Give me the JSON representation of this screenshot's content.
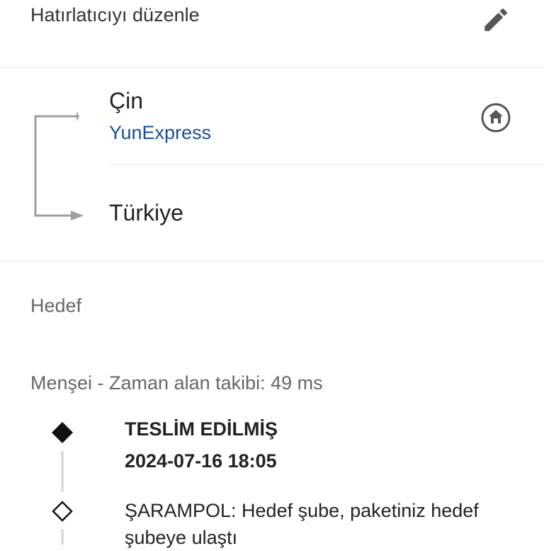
{
  "header": {
    "reminder_label": "Hatırlatıcıyı düzenle",
    "edit_icon": "pencil-icon"
  },
  "route": {
    "origin": "Çin",
    "carrier": "YunExpress",
    "destination": "Türkiye",
    "home_icon": "home-icon"
  },
  "destination_section": {
    "label": "Hedef"
  },
  "origin_section": {
    "tracking_info": "Menşei - Zaman alan takibi: 49 ms"
  },
  "events": [
    {
      "status": "TESLİM EDİLMİŞ",
      "time": "2024-07-16 18:05",
      "marker": "filled-diamond-icon"
    },
    {
      "description": "ŞARAMPOL: Hedef şube, paketiniz hedef şubeye ulaştı",
      "marker": "outline-diamond-icon"
    }
  ],
  "colors": {
    "carrier_link": "#1a4e96",
    "divider": "#e6e6e6",
    "icon": "#555555"
  }
}
